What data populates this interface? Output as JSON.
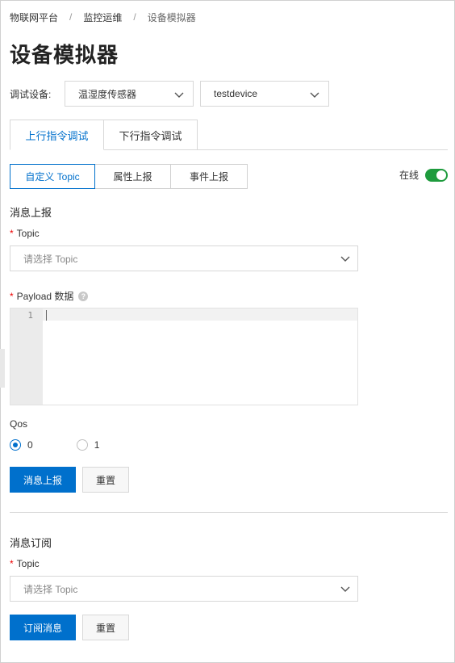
{
  "breadcrumb": [
    "物联网平台",
    "监控运维",
    "设备模拟器"
  ],
  "breadcrumb_sep": "/",
  "page_title": "设备模拟器",
  "device_select": {
    "label": "调试设备:",
    "product": "温湿度传感器",
    "device": "testdevice"
  },
  "tabs": [
    "上行指令调试",
    "下行指令调试"
  ],
  "segments": [
    "自定义 Topic",
    "属性上报",
    "事件上报"
  ],
  "online": {
    "label": "在线",
    "enabled": true
  },
  "publish": {
    "section_title": "消息上报",
    "topic_label": "Topic",
    "topic_placeholder": "请选择 Topic",
    "payload_label": "Payload 数据",
    "help_glyph": "?",
    "editor_line_number": "1",
    "qos_label": "Qos",
    "qos_options": [
      "0",
      "1"
    ],
    "qos_selected": "0",
    "submit_label": "消息上报",
    "reset_label": "重置"
  },
  "subscribe": {
    "section_title": "消息订阅",
    "topic_label": "Topic",
    "topic_placeholder": "请选择 Topic",
    "submit_label": "订阅消息",
    "reset_label": "重置"
  },
  "required_mark": "*",
  "colors": {
    "primary": "#0070cc",
    "toggle_on": "#1e9b3d",
    "required": "#ee0000"
  }
}
